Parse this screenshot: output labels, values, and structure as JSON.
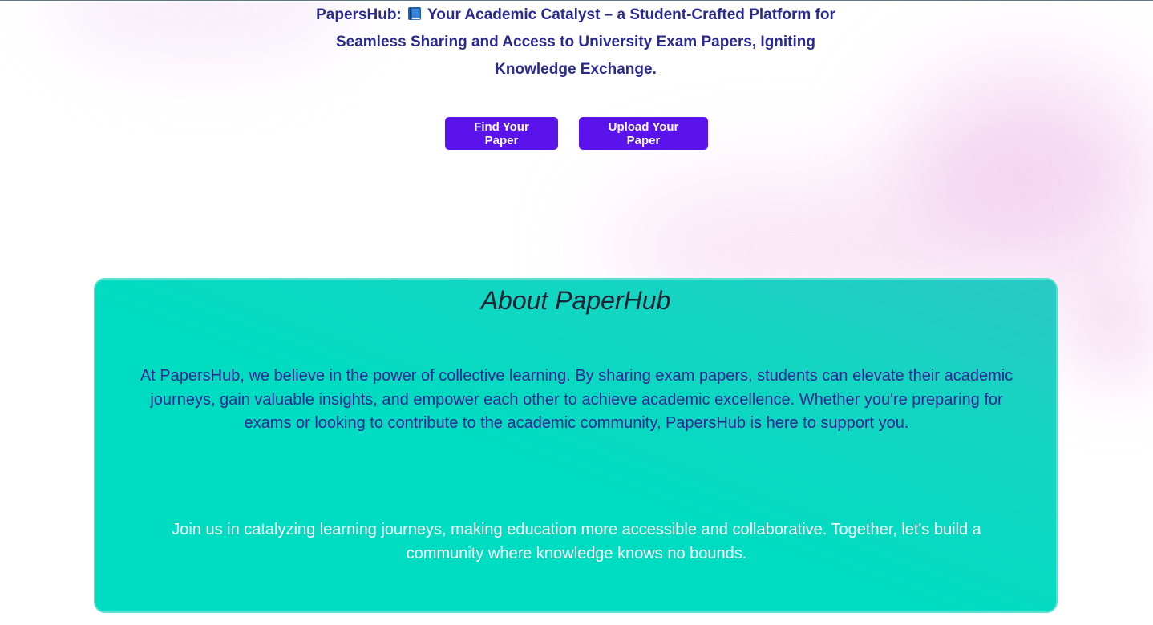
{
  "hero": {
    "tagline_prefix": "PapersHub:",
    "tagline_icon": "book-icon",
    "tagline_rest": "Your Academic Catalyst – a Student-Crafted Platform for Seamless Sharing and Access to University Exam Papers, Igniting Knowledge Exchange.",
    "buttons": {
      "find_label": "Find Your Paper",
      "upload_label": "Upload Your Paper"
    }
  },
  "about": {
    "title": "About PaperHub",
    "paragraph1": "At PapersHub, we believe in the power of collective learning. By sharing exam papers, students can elevate their academic journeys, gain valuable insights, and empower each other to achieve academic excellence. Whether you're preparing for exams or looking to contribute to the academic community, PapersHub is here to support you.",
    "paragraph2": "Join us in catalyzing learning journeys, making education more accessible and collaborative. Together, let's build a community where knowledge knows no bounds."
  },
  "colors": {
    "accent_button": "#5b13ec",
    "tagline_text": "#2a2a8c",
    "card_background": "#00dcc1",
    "card_border": "#56e2cf"
  }
}
